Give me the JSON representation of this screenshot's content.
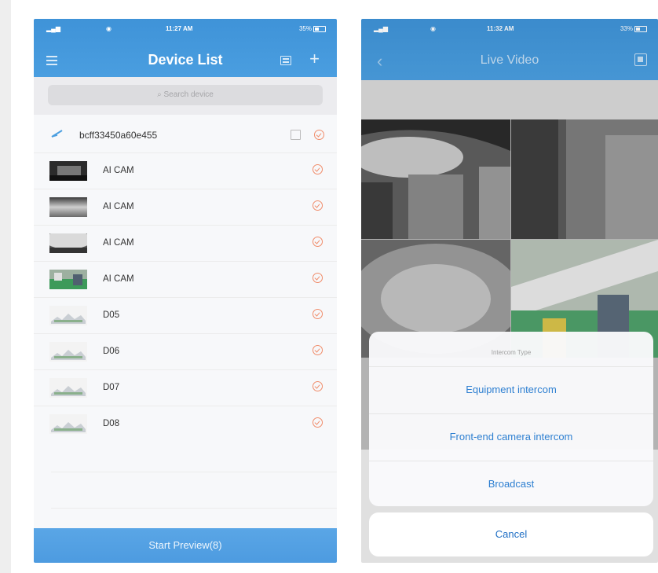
{
  "left": {
    "status": {
      "time": "11:27 AM",
      "battery": "35%"
    },
    "title": "Device List",
    "search_placeholder": "Search device",
    "group": {
      "name": "bcff33450a60e455"
    },
    "devices": [
      {
        "name": "AI CAM",
        "thumb": "dark-scene"
      },
      {
        "name": "AI CAM",
        "thumb": "grey-gradient"
      },
      {
        "name": "AI CAM",
        "thumb": "fisheye"
      },
      {
        "name": "AI CAM",
        "thumb": "green-room"
      },
      {
        "name": "D05",
        "thumb": "placeholder"
      },
      {
        "name": "D06",
        "thumb": "placeholder"
      },
      {
        "name": "D07",
        "thumb": "placeholder"
      },
      {
        "name": "D08",
        "thumb": "placeholder"
      }
    ],
    "start_preview": "Start Preview(8)",
    "colors": {
      "header": "#4a9ee0",
      "check": "#f08c6a"
    }
  },
  "right": {
    "status": {
      "time": "11:32 AM",
      "battery": "33%"
    },
    "title": "Live Video",
    "sheet": {
      "title": "Intercom Type",
      "options": [
        "Equipment intercom",
        "Front-end camera intercom",
        "Broadcast"
      ],
      "cancel": "Cancel"
    },
    "colors": {
      "option_text": "#2d7fd1"
    }
  }
}
